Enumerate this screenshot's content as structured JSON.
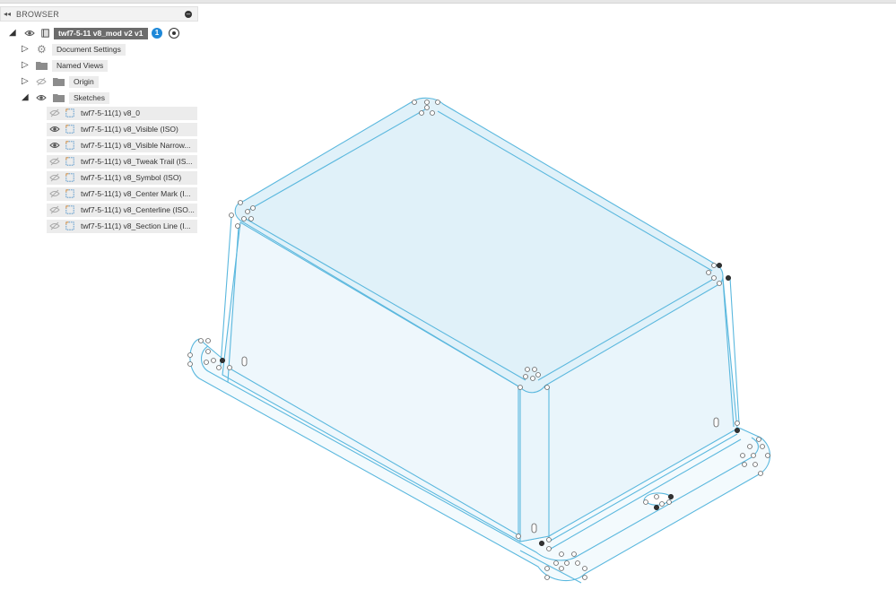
{
  "browser": {
    "title": "BROWSER",
    "root": {
      "label": "twf7-5-11 v8_mod v2 v1"
    },
    "items": [
      {
        "label": "Document Settings",
        "icon": "gear-icon"
      },
      {
        "label": "Named Views",
        "icon": "folder-icon"
      },
      {
        "label": "Origin",
        "icon": "folder-icon"
      },
      {
        "label": "Sketches",
        "icon": "folder-icon"
      }
    ],
    "sketches": [
      {
        "label": "twf7-5-11(1) v8_0",
        "visible": false
      },
      {
        "label": "twf7-5-11(1) v8_Visible (ISO)",
        "visible": true
      },
      {
        "label": "twf7-5-11(1) v8_Visible Narrow...",
        "visible": true
      },
      {
        "label": "twf7-5-11(1) v8_Tweak Trail (IS...",
        "visible": false
      },
      {
        "label": "twf7-5-11(1) v8_Symbol (ISO)",
        "visible": false
      },
      {
        "label": "twf7-5-11(1) v8_Center Mark (I...",
        "visible": false
      },
      {
        "label": "twf7-5-11(1) v8_Centerline (ISO...",
        "visible": false
      },
      {
        "label": "twf7-5-11(1) v8_Section Line (I...",
        "visible": false
      }
    ]
  },
  "colors": {
    "edge": "#5bb8de",
    "face_top": "#e2f2fa",
    "face_side": "#edf7fc",
    "flange": "#f3fafd",
    "sketch_accent": "#e58a2a"
  }
}
